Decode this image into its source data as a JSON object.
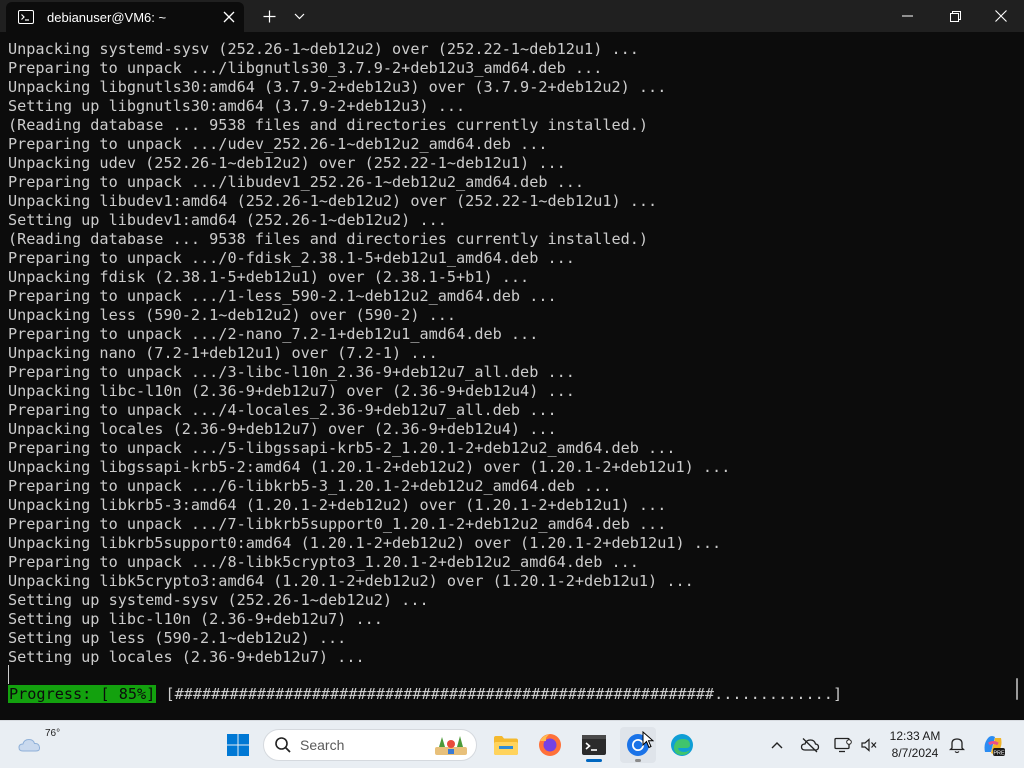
{
  "window": {
    "tab_title": "debianuser@VM6: ~"
  },
  "terminal": {
    "lines": [
      "Unpacking systemd-sysv (252.26-1~deb12u2) over (252.22-1~deb12u1) ...",
      "Preparing to unpack .../libgnutls30_3.7.9-2+deb12u3_amd64.deb ...",
      "Unpacking libgnutls30:amd64 (3.7.9-2+deb12u3) over (3.7.9-2+deb12u2) ...",
      "Setting up libgnutls30:amd64 (3.7.9-2+deb12u3) ...",
      "(Reading database ... 9538 files and directories currently installed.)",
      "Preparing to unpack .../udev_252.26-1~deb12u2_amd64.deb ...",
      "Unpacking udev (252.26-1~deb12u2) over (252.22-1~deb12u1) ...",
      "Preparing to unpack .../libudev1_252.26-1~deb12u2_amd64.deb ...",
      "Unpacking libudev1:amd64 (252.26-1~deb12u2) over (252.22-1~deb12u1) ...",
      "Setting up libudev1:amd64 (252.26-1~deb12u2) ...",
      "(Reading database ... 9538 files and directories currently installed.)",
      "Preparing to unpack .../0-fdisk_2.38.1-5+deb12u1_amd64.deb ...",
      "Unpacking fdisk (2.38.1-5+deb12u1) over (2.38.1-5+b1) ...",
      "Preparing to unpack .../1-less_590-2.1~deb12u2_amd64.deb ...",
      "Unpacking less (590-2.1~deb12u2) over (590-2) ...",
      "Preparing to unpack .../2-nano_7.2-1+deb12u1_amd64.deb ...",
      "Unpacking nano (7.2-1+deb12u1) over (7.2-1) ...",
      "Preparing to unpack .../3-libc-l10n_2.36-9+deb12u7_all.deb ...",
      "Unpacking libc-l10n (2.36-9+deb12u7) over (2.36-9+deb12u4) ...",
      "Preparing to unpack .../4-locales_2.36-9+deb12u7_all.deb ...",
      "Unpacking locales (2.36-9+deb12u7) over (2.36-9+deb12u4) ...",
      "Preparing to unpack .../5-libgssapi-krb5-2_1.20.1-2+deb12u2_amd64.deb ...",
      "Unpacking libgssapi-krb5-2:amd64 (1.20.1-2+deb12u2) over (1.20.1-2+deb12u1) ...",
      "Preparing to unpack .../6-libkrb5-3_1.20.1-2+deb12u2_amd64.deb ...",
      "Unpacking libkrb5-3:amd64 (1.20.1-2+deb12u2) over (1.20.1-2+deb12u1) ...",
      "Preparing to unpack .../7-libkrb5support0_1.20.1-2+deb12u2_amd64.deb ...",
      "Unpacking libkrb5support0:amd64 (1.20.1-2+deb12u2) over (1.20.1-2+deb12u1) ...",
      "Preparing to unpack .../8-libk5crypto3_1.20.1-2+deb12u2_amd64.deb ...",
      "Unpacking libk5crypto3:amd64 (1.20.1-2+deb12u2) over (1.20.1-2+deb12u1) ...",
      "Setting up systemd-sysv (252.26-1~deb12u2) ...",
      "Setting up libc-l10n (2.36-9+deb12u7) ...",
      "Setting up less (590-2.1~deb12u2) ...",
      "Setting up locales (2.36-9+deb12u7) ..."
    ],
    "progress_label": "Progress: [ 85%]",
    "progress_bar": " [###########################################################.............]",
    "progress_fraction": 0.85
  },
  "taskbar": {
    "weather_temp": "76°",
    "search_label": "Search",
    "clock_time": "12:33 AM",
    "clock_date": "8/7/2024",
    "icons": {
      "start": "windows-start-icon",
      "explorer": "folder-icon",
      "firefox": "firefox-icon",
      "terminal": "terminal-icon",
      "chrome": "chrome-icon",
      "edge": "edge-icon",
      "copilot": "copilot-icon"
    }
  },
  "colors": {
    "terminal_bg": "#0c0c0c",
    "terminal_fg": "#cccccc",
    "progress_green": "#13a10e",
    "taskbar_bg": "#e9eef3",
    "accent": "#0078d4"
  }
}
